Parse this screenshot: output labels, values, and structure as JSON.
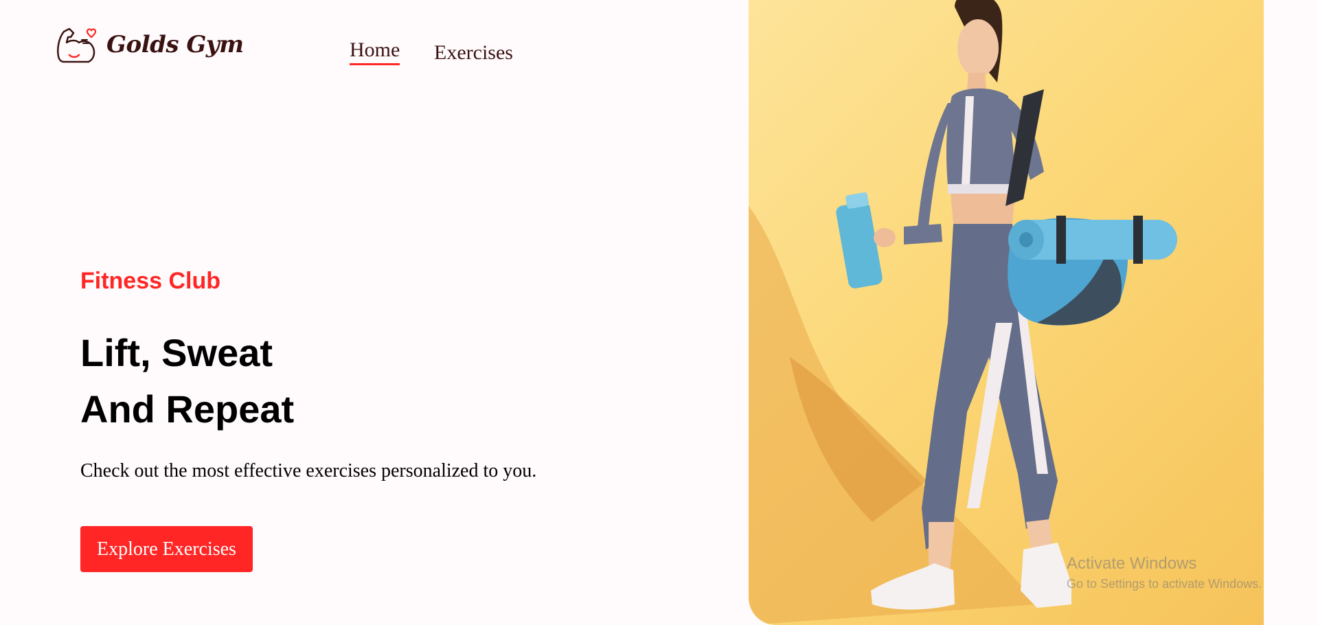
{
  "brand": {
    "name": "Golds Gym"
  },
  "nav": {
    "items": [
      {
        "label": "Home",
        "active": true
      },
      {
        "label": "Exercises",
        "active": false
      }
    ]
  },
  "hero": {
    "kicker": "Fitness Club",
    "title_line1": "Lift, Sweat",
    "title_line2": "And Repeat",
    "description": "Check out the most effective exercises personalized to you.",
    "cta_label": "Explore Exercises"
  },
  "banner": {
    "subject": "woman in gym outfit walking with water bottle, gym bag and yoga mat"
  },
  "watermark": {
    "line1": "Activate Windows",
    "line2": "Go to Settings to activate Windows."
  },
  "colors": {
    "accent": "#ff2625",
    "background": "#fffafb",
    "text_dark": "#3a1212",
    "banner_bg": "#fcd777"
  }
}
